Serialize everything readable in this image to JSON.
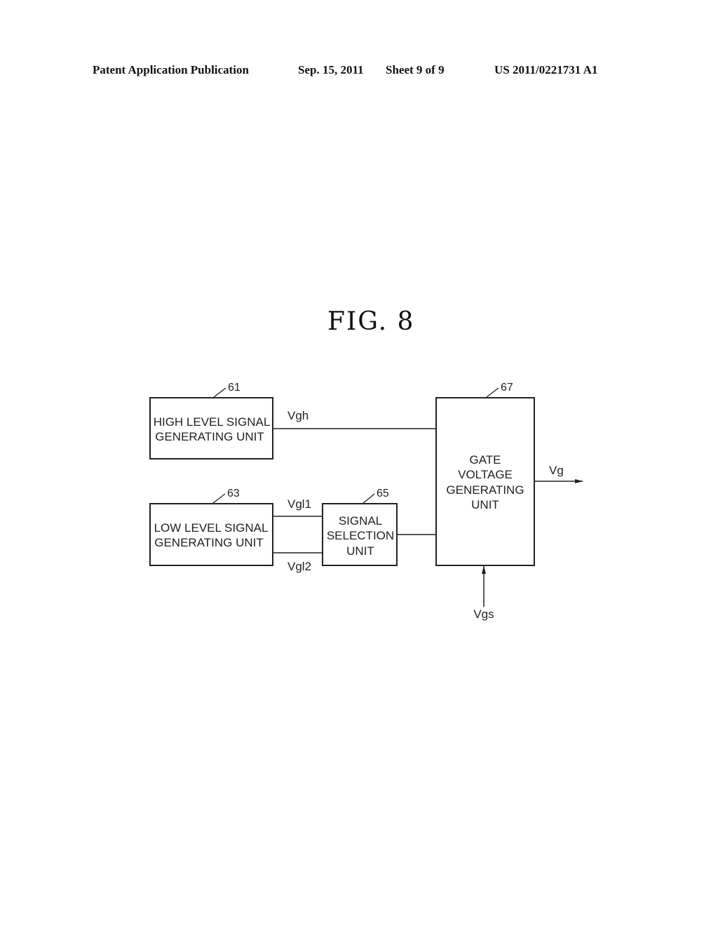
{
  "header": {
    "publication_type": "Patent Application Publication",
    "date": "Sep. 15, 2011",
    "sheet": "Sheet 9 of 9",
    "pub_number": "US 2011/0221731 A1"
  },
  "figure": {
    "title": "FIG.  8",
    "blocks": [
      {
        "ref": "61",
        "lines": [
          "HIGH LEVEL SIGNAL",
          "GENERATING UNIT"
        ]
      },
      {
        "ref": "63",
        "lines": [
          "LOW LEVEL SIGNAL",
          "GENERATING UNIT"
        ]
      },
      {
        "ref": "65",
        "lines": [
          "SIGNAL",
          "SELECTION",
          "UNIT"
        ]
      },
      {
        "ref": "67",
        "lines": [
          "GATE",
          "VOLTAGE",
          "GENERATING",
          "UNIT"
        ]
      }
    ],
    "signals": {
      "vgh": "Vgh",
      "vgl1": "Vgl1",
      "vgl2": "Vgl2",
      "vg": "Vg",
      "vgs": "Vgs"
    }
  }
}
